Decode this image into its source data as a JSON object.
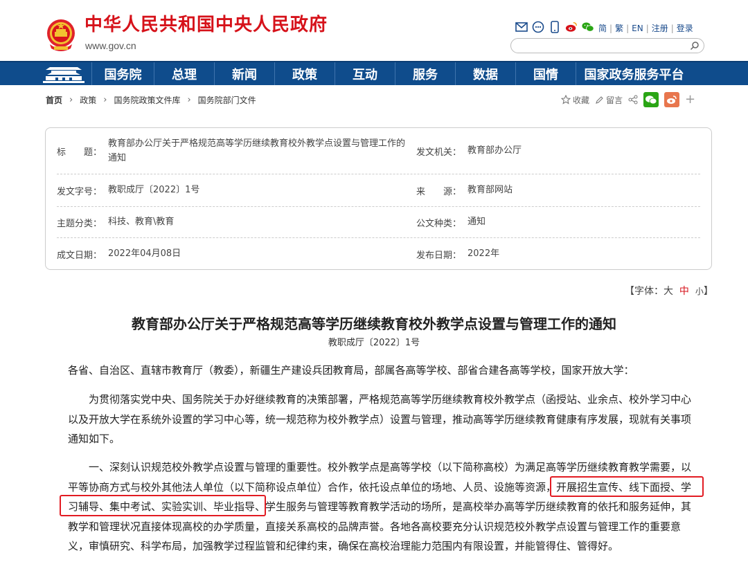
{
  "header": {
    "site_title": "中华人民共和国中央人民政府",
    "site_url": "www.gov.cn",
    "links": [
      "简",
      "繁",
      "EN",
      "注册",
      "登录"
    ],
    "icons": [
      "mail-icon",
      "chat-bubble-icon",
      "mobile-icon",
      "weibo-icon",
      "wechat-icon"
    ],
    "search_placeholder": ""
  },
  "nav": {
    "items": [
      "国务院",
      "总理",
      "新闻",
      "政策",
      "互动",
      "服务",
      "数据",
      "国情",
      "国家政务服务平台"
    ]
  },
  "breadcrumb": [
    "首页",
    "政策",
    "国务院政策文件库",
    "国务院部门文件"
  ],
  "tools": {
    "favorite": "收藏",
    "comment": "留言"
  },
  "info": {
    "title_label": "标　　题：",
    "title_value_line1": "教育部办公厅关于严格规范高等学历继续教育校外教学点设置与管理工作的",
    "title_value_line2": "通知",
    "issuer_label": "发文机关：",
    "issuer_value": "教育部办公厅",
    "doc_no_label": "发文字号：",
    "doc_no_value": "教职成厅〔2022〕1号",
    "source_label": "来　　源：",
    "source_value": "教育部网站",
    "topic_label": "主题分类：",
    "topic_value": "科技、教育\\教育",
    "type_label": "公文种类：",
    "type_value": "通知",
    "date_label": "成文日期：",
    "date_value": "2022年04月08日",
    "publish_label": "发布日期：",
    "publish_value": "2022年"
  },
  "font_size": {
    "prefix": "【字体：",
    "large": "大",
    "medium": "中",
    "small": "小",
    "suffix": "】"
  },
  "article": {
    "title": "教育部办公厅关于严格规范高等学历继续教育校外教学点设置与管理工作的通知",
    "doc_no": "教职成厅〔2022〕1号",
    "p1": "各省、自治区、直辖市教育厅（教委），新疆生产建设兵团教育局，部属各高等学校、部省合建各高等学校，国家开放大学：",
    "p2_l1": "　　为贯彻落实党中央、国务院关于办好继续教育的决策部署，严格规范高等学历继续教育校外教学点（函授站、业余点、校外学习中心",
    "p2_l2": "以及开放大学在系统外设置的学习中心等，统一规范称为校外教学点）设置与管理，推动高等学历继续教育健康有序发展，现就有关事项",
    "p2_l3": "通知如下。",
    "p3_l1": "　　一、深刻认识规范校外教学点设置与管理的重要性。校外教学点是高等学校（以下简称高校）为满足高等学历继续教育教学需要，以",
    "p3_l2": "平等协商方式与校外其他法人单位（以下简称设点单位）合作，依托设点单位的场地、人员、设施等资源，开展招生宣传、线下面授、学",
    "p3_l3": "习辅导、集中考试、实验实训、毕业指导、学生服务与管理等教育教学活动的场所，是高校举办高等学历继续教育的依托和服务延伸，其",
    "p3_l4": "教学和管理状况直接体现高校的办学质量，直接关系高校的品牌声誉。各地各高校要充分认识规范校外教学点设置与管理工作的重要意",
    "p3_l5": "义，审慎研究、科学布局，加强教学过程监管和纪律约束，确保在高校治理能力范围内有限设置，并能管得住、管得好。"
  },
  "colors": {
    "brand_red": "#d6121a",
    "nav_blue": "#0f4c8c",
    "highlight_red": "#e21b22"
  }
}
